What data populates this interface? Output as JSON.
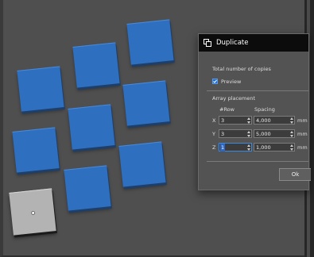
{
  "dialog": {
    "title": "Duplicate",
    "total_label": "Total number of copies",
    "preview_label": "Preview",
    "preview_checked": true,
    "array_label": "Array placement",
    "col_row": "#Row",
    "col_spacing": "Spacing",
    "rows": [
      {
        "axis": "X",
        "count": "3",
        "spacing": "4,000",
        "unit": "mm"
      },
      {
        "axis": "Y",
        "count": "3",
        "spacing": "5,000",
        "unit": "mm"
      },
      {
        "axis": "Z",
        "count": "1",
        "spacing": "1,000",
        "unit": "mm"
      }
    ],
    "ok_label": "Ok"
  },
  "viewport": {
    "tile_color": "#2e6fc0",
    "original_tile_color": "#b3b3b3",
    "accent_color": "#2d68c8"
  }
}
